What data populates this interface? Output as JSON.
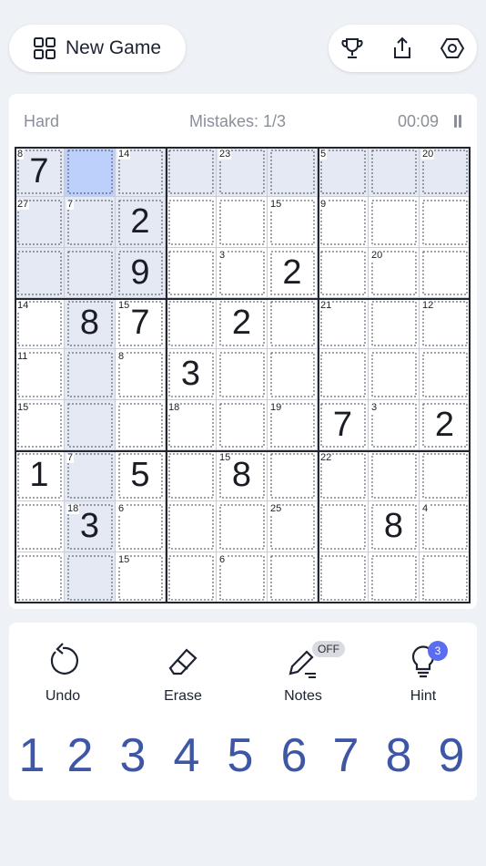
{
  "header": {
    "new_game_label": "New Game",
    "icons": [
      "grid-icon",
      "trophy-icon",
      "share-icon",
      "settings-hexagon-icon"
    ]
  },
  "status": {
    "difficulty": "Hard",
    "mistakes": "Mistakes: 1/3",
    "timer": "00:09"
  },
  "board": {
    "values": [
      "7",
      "",
      "",
      "",
      "",
      "",
      "",
      "",
      "",
      "",
      "",
      "2",
      "",
      "",
      "",
      "",
      "",
      "",
      "",
      "",
      "9",
      "",
      "",
      "2",
      "",
      "",
      "",
      "",
      "8",
      "7",
      "",
      "2",
      "",
      "",
      "",
      "",
      "",
      "",
      "",
      "3",
      "",
      "",
      "",
      "",
      "",
      "",
      "",
      "",
      "",
      "",
      "",
      "7",
      "",
      "2",
      "1",
      "",
      "5",
      "",
      "8",
      "",
      "",
      "",
      "",
      "",
      "3",
      "",
      "",
      "",
      "",
      "",
      "8",
      "",
      "",
      "",
      "",
      "",
      "",
      "",
      "",
      "",
      ""
    ],
    "cage_sums": [
      {
        "r": 0,
        "c": 0,
        "sum": "8"
      },
      {
        "r": 0,
        "c": 2,
        "sum": "14"
      },
      {
        "r": 0,
        "c": 4,
        "sum": "23"
      },
      {
        "r": 0,
        "c": 6,
        "sum": "5"
      },
      {
        "r": 0,
        "c": 8,
        "sum": "20"
      },
      {
        "r": 1,
        "c": 0,
        "sum": "27"
      },
      {
        "r": 1,
        "c": 1,
        "sum": "7"
      },
      {
        "r": 1,
        "c": 5,
        "sum": "15"
      },
      {
        "r": 1,
        "c": 6,
        "sum": "9"
      },
      {
        "r": 2,
        "c": 4,
        "sum": "3"
      },
      {
        "r": 2,
        "c": 7,
        "sum": "20"
      },
      {
        "r": 3,
        "c": 0,
        "sum": "14"
      },
      {
        "r": 3,
        "c": 2,
        "sum": "15"
      },
      {
        "r": 3,
        "c": 6,
        "sum": "21"
      },
      {
        "r": 3,
        "c": 8,
        "sum": "12"
      },
      {
        "r": 4,
        "c": 0,
        "sum": "11"
      },
      {
        "r": 4,
        "c": 2,
        "sum": "8"
      },
      {
        "r": 5,
        "c": 0,
        "sum": "15"
      },
      {
        "r": 5,
        "c": 3,
        "sum": "18"
      },
      {
        "r": 5,
        "c": 5,
        "sum": "19"
      },
      {
        "r": 5,
        "c": 7,
        "sum": "3"
      },
      {
        "r": 6,
        "c": 1,
        "sum": "7"
      },
      {
        "r": 6,
        "c": 4,
        "sum": "15"
      },
      {
        "r": 6,
        "c": 6,
        "sum": "22"
      },
      {
        "r": 7,
        "c": 1,
        "sum": "18"
      },
      {
        "r": 7,
        "c": 2,
        "sum": "6"
      },
      {
        "r": 7,
        "c": 5,
        "sum": "25"
      },
      {
        "r": 7,
        "c": 8,
        "sum": "4"
      },
      {
        "r": 8,
        "c": 2,
        "sum": "15"
      },
      {
        "r": 8,
        "c": 4,
        "sum": "6"
      }
    ],
    "selected": {
      "r": 0,
      "c": 1
    },
    "colors": {
      "selected": "#bcd0fb",
      "highlight": "#e4e9f4",
      "highlight_light": "#f0f3f9",
      "digit": "#1a1d24",
      "numpad": "#3d56a6"
    }
  },
  "tools": [
    {
      "label": "Undo",
      "icon": "undo-icon"
    },
    {
      "label": "Erase",
      "icon": "eraser-icon"
    },
    {
      "label": "Notes",
      "icon": "pencil-icon",
      "badge": "OFF"
    },
    {
      "label": "Hint",
      "icon": "lightbulb-icon",
      "badge": "3"
    }
  ],
  "numpad": [
    "1",
    "2",
    "3",
    "4",
    "5",
    "6",
    "7",
    "8",
    "9"
  ]
}
